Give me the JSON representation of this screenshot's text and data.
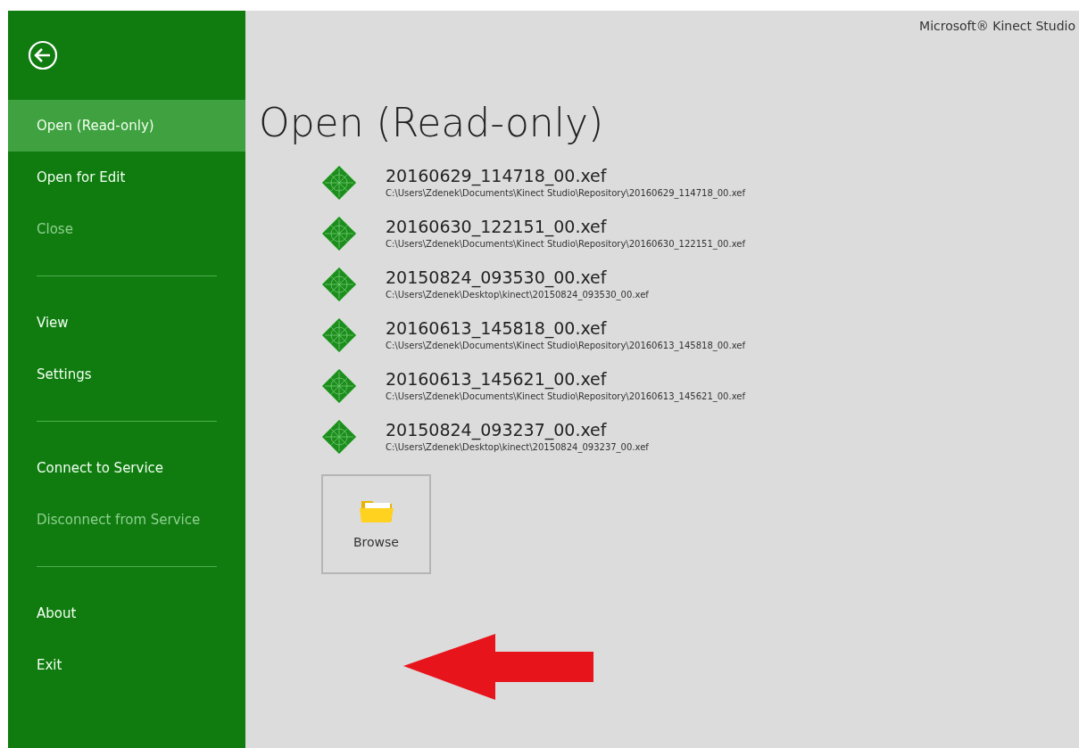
{
  "app_title": "Microsoft® Kinect Studio",
  "sidebar": {
    "items": [
      {
        "kind": "item",
        "label": "Open (Read-only)",
        "selected": true,
        "disabled": false
      },
      {
        "kind": "item",
        "label": "Open for Edit",
        "selected": false,
        "disabled": false
      },
      {
        "kind": "item",
        "label": "Close",
        "selected": false,
        "disabled": true
      },
      {
        "kind": "separator"
      },
      {
        "kind": "item",
        "label": "View",
        "selected": false,
        "disabled": false
      },
      {
        "kind": "item",
        "label": "Settings",
        "selected": false,
        "disabled": false
      },
      {
        "kind": "separator"
      },
      {
        "kind": "item",
        "label": "Connect to Service",
        "selected": false,
        "disabled": false
      },
      {
        "kind": "item",
        "label": "Disconnect from Service",
        "selected": false,
        "disabled": true
      },
      {
        "kind": "separator"
      },
      {
        "kind": "item",
        "label": "About",
        "selected": false,
        "disabled": false
      },
      {
        "kind": "item",
        "label": "Exit",
        "selected": false,
        "disabled": false
      }
    ]
  },
  "heading": "Open (Read-only)",
  "recent_files": [
    {
      "name": "20160629_114718_00.xef",
      "path": "C:\\Users\\Zdenek\\Documents\\Kinect Studio\\Repository\\20160629_114718_00.xef"
    },
    {
      "name": "20160630_122151_00.xef",
      "path": "C:\\Users\\Zdenek\\Documents\\Kinect Studio\\Repository\\20160630_122151_00.xef"
    },
    {
      "name": "20150824_093530_00.xef",
      "path": "C:\\Users\\Zdenek\\Desktop\\kinect\\20150824_093530_00.xef"
    },
    {
      "name": "20160613_145818_00.xef",
      "path": "C:\\Users\\Zdenek\\Documents\\Kinect Studio\\Repository\\20160613_145818_00.xef"
    },
    {
      "name": "20160613_145621_00.xef",
      "path": "C:\\Users\\Zdenek\\Documents\\Kinect Studio\\Repository\\20160613_145621_00.xef"
    },
    {
      "name": "20150824_093237_00.xef",
      "path": "C:\\Users\\Zdenek\\Desktop\\kinect\\20150824_093237_00.xef"
    }
  ],
  "browse_button": {
    "label": "Browse"
  }
}
